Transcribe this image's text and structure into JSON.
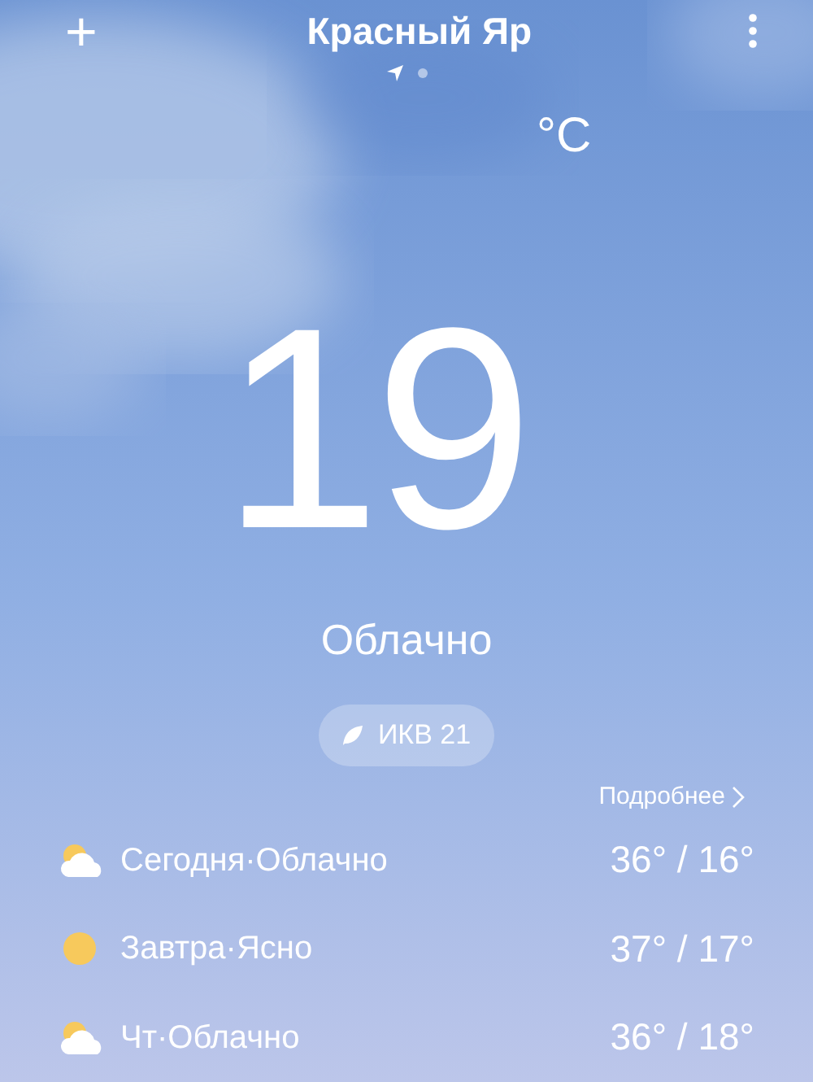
{
  "header": {
    "city": "Красный Яр",
    "add_button": "+",
    "pages": [
      {
        "kind": "location",
        "selected": true
      },
      {
        "kind": "dot",
        "selected": false
      }
    ]
  },
  "current": {
    "temperature": "19",
    "unit": "°C",
    "condition": "Облачно",
    "aqi": "ИКВ 21"
  },
  "more_link": "Подробнее",
  "forecast": [
    {
      "kind": "cloudy",
      "label": "Сегодня·Облачно",
      "temps": "36° / 16°"
    },
    {
      "kind": "sunny",
      "label": "Завтра·Ясно",
      "temps": "37° / 17°"
    },
    {
      "kind": "cloudy",
      "label": "Чт·Облачно",
      "temps": "36° / 18°"
    }
  ]
}
